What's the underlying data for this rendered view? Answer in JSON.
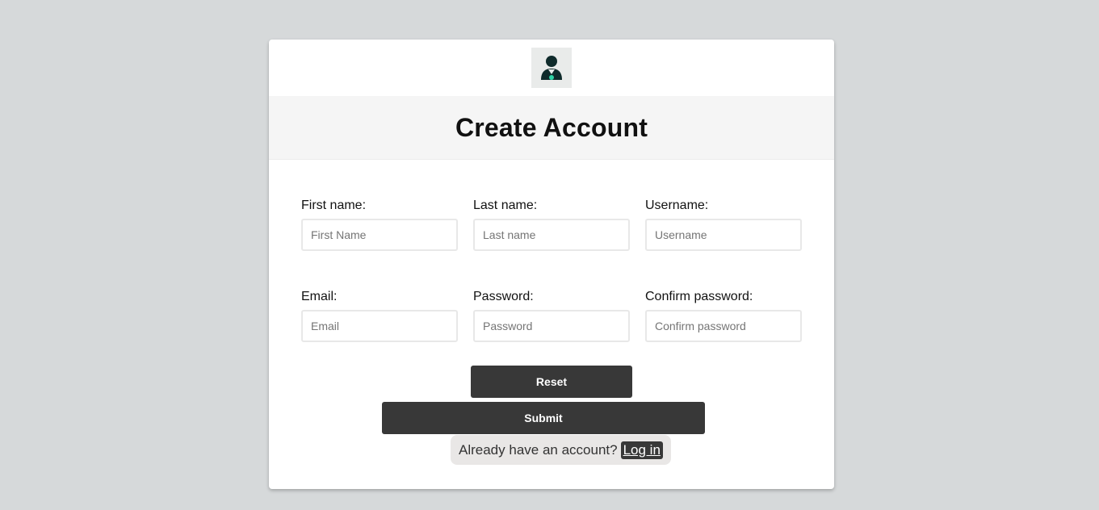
{
  "header": {
    "avatar_icon": "user-avatar-icon",
    "title": "Create Account"
  },
  "form": {
    "first_name": {
      "label": "First name:",
      "placeholder": "First Name",
      "value": ""
    },
    "last_name": {
      "label": "Last name:",
      "placeholder": "Last name",
      "value": ""
    },
    "username": {
      "label": "Username:",
      "placeholder": "Username",
      "value": ""
    },
    "email": {
      "label": "Email:",
      "placeholder": "Email",
      "value": ""
    },
    "password": {
      "label": "Password:",
      "placeholder": "Password",
      "value": ""
    },
    "confirm_password": {
      "label": "Confirm password:",
      "placeholder": "Confirm password",
      "value": ""
    }
  },
  "actions": {
    "reset_label": "Reset",
    "submit_label": "Submit"
  },
  "footer": {
    "prompt": "Already have an account?",
    "login_label": "Log in"
  },
  "colors": {
    "page_background": "#d6d9da",
    "card_background": "#ffffff",
    "button_background": "#383838",
    "avatar_accent": "#2fd3a6"
  }
}
